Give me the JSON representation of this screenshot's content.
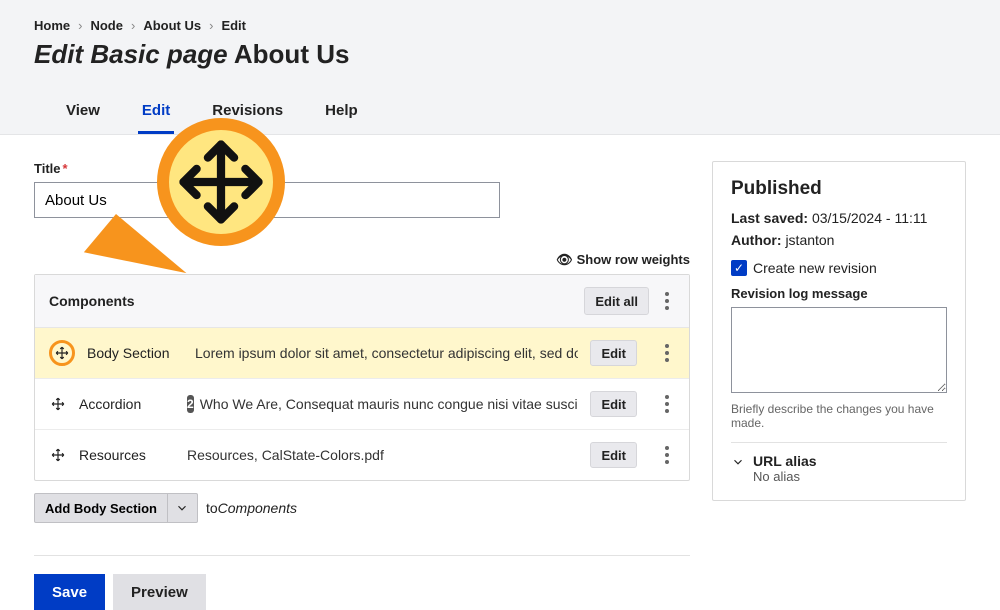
{
  "breadcrumb": [
    "Home",
    "Node",
    "About Us",
    "Edit"
  ],
  "page_title_prefix": "Edit Basic page",
  "page_title_name": "About Us",
  "tabs": {
    "view": "View",
    "edit": "Edit",
    "revisions": "Revisions",
    "help": "Help"
  },
  "fields": {
    "title_label": "Title",
    "title_value": "About Us"
  },
  "show_weights": "Show row weights",
  "components": {
    "heading": "Components",
    "edit_all": "Edit all",
    "edit": "Edit",
    "rows": [
      {
        "name": "Body Section",
        "desc": "Lorem ipsum dolor sit amet, consectetur adipiscing elit, sed do eiusmod tempor in...",
        "badge": null,
        "highlight": true,
        "circle": true
      },
      {
        "name": "Accordion",
        "desc": "Who We Are, Consequat mauris nunc congue nisi vitae suscipit tellus. Mollis nu...",
        "badge": "2",
        "highlight": false,
        "circle": false
      },
      {
        "name": "Resources",
        "desc": "Resources, CalState-Colors.pdf",
        "badge": null,
        "highlight": false,
        "circle": false
      }
    ],
    "add_button": "Add Body Section",
    "to_text": "to",
    "to_target": "Components"
  },
  "actions": {
    "save": "Save",
    "preview": "Preview"
  },
  "sidebar": {
    "status": "Published",
    "last_saved_label": "Last saved:",
    "last_saved_value": "03/15/2024 - 11:11",
    "author_label": "Author:",
    "author_value": "jstanton",
    "create_revision": "Create new revision",
    "revlog_label": "Revision log message",
    "revlog_hint": "Briefly describe the changes you have made.",
    "url_alias_label": "URL alias",
    "url_alias_value": "No alias"
  }
}
